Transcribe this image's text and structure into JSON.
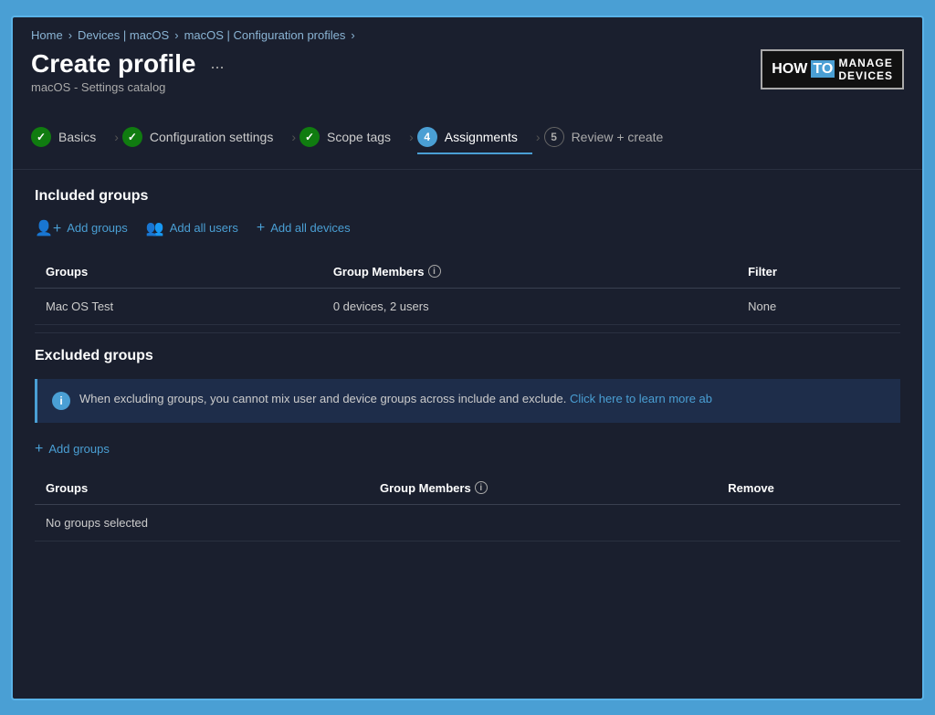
{
  "breadcrumb": {
    "items": [
      "Home",
      "Devices | macOS",
      "macOS | Configuration profiles"
    ]
  },
  "header": {
    "title": "Create profile",
    "more_btn": "...",
    "subtitle": "macOS - Settings catalog"
  },
  "logo": {
    "how": "HOW",
    "to": "TO",
    "manage": "MANAGE",
    "devices": "DEVICES"
  },
  "wizard": {
    "steps": [
      {
        "id": "basics",
        "label": "Basics",
        "type": "check",
        "num": "1"
      },
      {
        "id": "config",
        "label": "Configuration settings",
        "type": "check",
        "num": "2"
      },
      {
        "id": "scope",
        "label": "Scope tags",
        "type": "check",
        "num": "3"
      },
      {
        "id": "assignments",
        "label": "Assignments",
        "type": "num-active",
        "num": "4",
        "active": true
      },
      {
        "id": "review",
        "label": "Review + create",
        "type": "num",
        "num": "5"
      }
    ]
  },
  "included_groups": {
    "title": "Included groups",
    "actions": [
      {
        "id": "add-groups",
        "icon": "👤+",
        "label": "Add groups"
      },
      {
        "id": "add-all-users",
        "icon": "👥",
        "label": "Add all users"
      },
      {
        "id": "add-all-devices",
        "icon": "+",
        "label": "Add all devices"
      }
    ],
    "table": {
      "columns": [
        {
          "id": "groups",
          "label": "Groups",
          "info": false
        },
        {
          "id": "members",
          "label": "Group Members",
          "info": true
        },
        {
          "id": "filter",
          "label": "Filter",
          "info": false
        }
      ],
      "rows": [
        {
          "group": "Mac OS Test",
          "members": "0 devices, 2 users",
          "filter": "None"
        }
      ]
    }
  },
  "excluded_groups": {
    "title": "Excluded groups",
    "info_message": "When excluding groups, you cannot mix user and device groups across include and exclude.",
    "info_link_text": "Click here to learn more ab",
    "actions": [
      {
        "id": "add-excluded-groups",
        "icon": "+",
        "label": "Add groups"
      }
    ],
    "table": {
      "columns": [
        {
          "id": "groups",
          "label": "Groups",
          "info": false
        },
        {
          "id": "members",
          "label": "Group Members",
          "info": true
        },
        {
          "id": "remove",
          "label": "Remove",
          "info": false
        }
      ],
      "rows": [
        {
          "group": "No groups selected",
          "members": "",
          "remove": ""
        }
      ]
    }
  }
}
